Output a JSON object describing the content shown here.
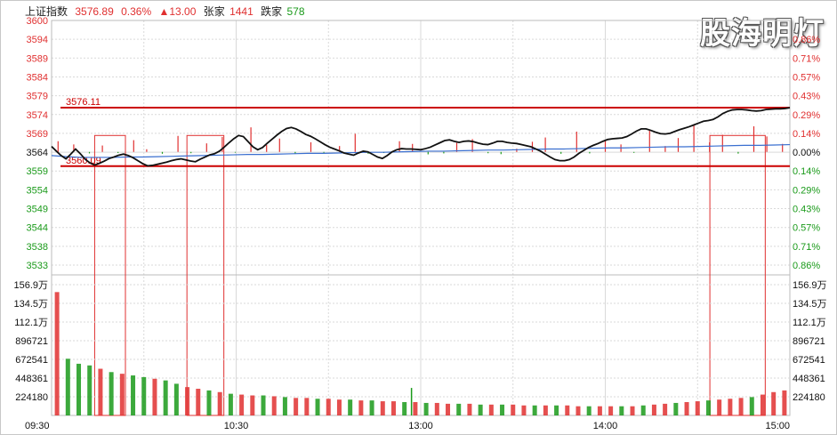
{
  "header": {
    "index_name": "上证指数",
    "price": "3576.89",
    "change_pct": "0.36%",
    "change_pts": "▲13.00",
    "up_label": "张家",
    "up_count": "1441",
    "down_label": "跌家",
    "down_count": "578"
  },
  "watermark": "股海明灯",
  "colors": {
    "up": "#e03030",
    "down": "#1a9a1a",
    "index_line": "#111111",
    "avg_line": "#3a6fd0",
    "grid": "#d9d9d9",
    "ref": "#cc0000"
  },
  "chart_data": [
    {
      "type": "line",
      "y_ticks_left": [
        "3600",
        "3594",
        "3589",
        "3584",
        "3579",
        "3574",
        "3569",
        "3564",
        "3559",
        "3554",
        "3549",
        "3544",
        "3538",
        "3533"
      ],
      "y_ticks_right": [
        "0.86%",
        "0.71%",
        "0.57%",
        "0.43%",
        "0.29%",
        "0.14%",
        "0.00%",
        "0.14%",
        "0.29%",
        "0.43%",
        "0.57%",
        "0.71%",
        "0.86%"
      ],
      "ylim": [
        3533,
        3600
      ],
      "prev_close": 3564,
      "x_ticks": [
        "09:30",
        "10:30",
        "13:00",
        "14:00",
        "15:00"
      ],
      "annotations": [
        {
          "text": "3576.11",
          "value": 3576.11
        },
        {
          "text": "3560.09",
          "value": 3560.09
        }
      ],
      "series": [],
      "price": [
        3565.5,
        3564.2,
        3563.0,
        3562.1,
        3563.4,
        3564.8,
        3563.5,
        3562.0,
        3561.0,
        3560.4,
        3560.9,
        3561.5,
        3562.2,
        3562.6,
        3563.1,
        3563.4,
        3563.0,
        3562.4,
        3561.6,
        3560.8,
        3560.2,
        3560.3,
        3560.6,
        3560.9,
        3561.2,
        3561.6,
        3561.9,
        3562.1,
        3561.8,
        3561.5,
        3561.3,
        3562.0,
        3562.6,
        3563.2,
        3563.5,
        3564.2,
        3565.3,
        3566.5,
        3567.6,
        3568.5,
        3568.2,
        3566.8,
        3565.4,
        3564.6,
        3565.2,
        3566.4,
        3567.5,
        3568.6,
        3569.6,
        3570.4,
        3570.7,
        3570.3,
        3569.6,
        3568.8,
        3568.3,
        3567.6,
        3566.8,
        3566.0,
        3565.3,
        3564.8,
        3564.3,
        3563.7,
        3563.4,
        3563.1,
        3563.7,
        3564.2,
        3564.0,
        3563.3,
        3562.6,
        3562.2,
        3563.0,
        3564.0,
        3564.6,
        3564.9,
        3564.8,
        3564.8,
        3564.7,
        3564.6,
        3564.9,
        3565.3,
        3565.9,
        3566.5,
        3567.1,
        3567.3,
        3566.9,
        3566.6,
        3566.9,
        3567.0,
        3566.8,
        3566.4,
        3566.1,
        3566.0,
        3566.4,
        3566.9,
        3566.9,
        3566.6,
        3566.4,
        3566.3,
        3566.0,
        3565.7,
        3565.4,
        3564.8,
        3564.2,
        3563.4,
        3562.6,
        3561.9,
        3561.6,
        3561.6,
        3561.9,
        3562.6,
        3563.6,
        3564.4,
        3565.2,
        3565.8,
        3566.3,
        3566.9,
        3567.4,
        3567.6,
        3567.7,
        3567.8,
        3568.2,
        3568.9,
        3569.7,
        3570.3,
        3570.3,
        3569.9,
        3569.4,
        3569.0,
        3568.9,
        3569.1,
        3569.6,
        3570.1,
        3570.5,
        3570.9,
        3571.4,
        3571.9,
        3572.4,
        3572.6,
        3572.9,
        3573.6,
        3574.5,
        3575.1,
        3575.5,
        3575.6,
        3575.6,
        3575.5,
        3575.3,
        3575.2,
        3575.3,
        3575.6,
        3575.7,
        3575.8,
        3575.8,
        3575.9,
        3576.1
      ],
      "avg": [
        3563.0,
        3562.7,
        3562.5,
        3562.5,
        3562.5,
        3562.6,
        3562.6,
        3562.7,
        3562.8,
        3562.9,
        3563.0,
        3563.1,
        3563.2,
        3563.3,
        3563.3,
        3563.4,
        3563.5,
        3563.6,
        3563.6,
        3563.7,
        3563.8,
        3563.9,
        3563.9,
        3564.0,
        3564.1,
        3564.2,
        3564.2,
        3564.3,
        3564.4,
        3564.5,
        3564.5,
        3564.6,
        3564.7,
        3564.8,
        3564.8,
        3564.9,
        3565.0,
        3565.1,
        3565.1,
        3565.2,
        3565.3,
        3565.4,
        3565.4,
        3565.5,
        3565.6,
        3565.7,
        3565.8,
        3565.8,
        3565.9,
        3566.0
      ],
      "bars_top": [
        {
          "v": 2.0,
          "c": "up"
        },
        {
          "v": 1.4,
          "c": "up"
        },
        {
          "v": 0.8,
          "c": "down"
        },
        {
          "v": 1.2,
          "c": "up"
        },
        {
          "v": 0.6,
          "c": "down"
        },
        {
          "v": 2.2,
          "c": "up"
        },
        {
          "v": 0.5,
          "c": "up"
        },
        {
          "v": 1.0,
          "c": "down"
        },
        {
          "v": 3.0,
          "c": "up"
        },
        {
          "v": 0.7,
          "c": "down"
        },
        {
          "v": 1.6,
          "c": "up"
        },
        {
          "v": 2.8,
          "c": "up"
        },
        {
          "v": 0.4,
          "c": "down"
        },
        {
          "v": 4.6,
          "c": "up"
        },
        {
          "v": 1.3,
          "c": "up"
        },
        {
          "v": 2.5,
          "c": "up"
        },
        {
          "v": 0.9,
          "c": "down"
        },
        {
          "v": 1.8,
          "c": "up"
        },
        {
          "v": 0.5,
          "c": "down"
        },
        {
          "v": 1.1,
          "c": "up"
        },
        {
          "v": 3.4,
          "c": "up"
        },
        {
          "v": 1.0,
          "c": "down"
        },
        {
          "v": 0.6,
          "c": "down"
        },
        {
          "v": 2.0,
          "c": "up"
        },
        {
          "v": 1.5,
          "c": "up"
        },
        {
          "v": 1.3,
          "c": "down"
        },
        {
          "v": 0.8,
          "c": "down"
        },
        {
          "v": 1.7,
          "c": "up"
        },
        {
          "v": 2.4,
          "c": "up"
        },
        {
          "v": 0.7,
          "c": "down"
        },
        {
          "v": 1.2,
          "c": "down"
        },
        {
          "v": 0.6,
          "c": "up"
        },
        {
          "v": 1.9,
          "c": "up"
        },
        {
          "v": 2.7,
          "c": "up"
        },
        {
          "v": 1.0,
          "c": "down"
        },
        {
          "v": 3.8,
          "c": "up"
        },
        {
          "v": 0.8,
          "c": "down"
        },
        {
          "v": 2.2,
          "c": "up"
        },
        {
          "v": 1.4,
          "c": "up"
        },
        {
          "v": 0.5,
          "c": "down"
        },
        {
          "v": 4.2,
          "c": "up"
        },
        {
          "v": 1.1,
          "c": "up"
        },
        {
          "v": 2.6,
          "c": "up"
        },
        {
          "v": 5.0,
          "c": "up"
        },
        {
          "v": 1.8,
          "c": "up"
        },
        {
          "v": 3.2,
          "c": "up"
        },
        {
          "v": 0.9,
          "c": "down"
        },
        {
          "v": 4.8,
          "c": "up"
        },
        {
          "v": 2.9,
          "c": "up"
        },
        {
          "v": 1.5,
          "c": "up"
        }
      ],
      "boxes": [
        {
          "from": "09:44",
          "to": "09:54"
        },
        {
          "from": "10:14",
          "to": "10:26"
        },
        {
          "from": "14:34",
          "to": "14:52"
        }
      ]
    },
    {
      "type": "bar",
      "y_ticks_left": [
        "156.9万",
        "134.5万",
        "112.1万",
        "896721",
        "672541",
        "448361",
        "224180"
      ],
      "y_ticks_right": [
        "156.9万",
        "134.5万",
        "112.1万",
        "896721",
        "672541",
        "448361",
        "224180"
      ],
      "unit_max": 1569000,
      "volume": [
        1480000,
        680000,
        620000,
        600000,
        560000,
        520000,
        500000,
        480000,
        460000,
        440000,
        420000,
        380000,
        340000,
        320000,
        300000,
        280000,
        260000,
        250000,
        240000,
        240000,
        230000,
        220000,
        210000,
        210000,
        200000,
        200000,
        190000,
        190000,
        180000,
        180000,
        170000,
        170000,
        160000,
        160000,
        150000,
        150000,
        140000,
        140000,
        140000,
        130000,
        130000,
        130000,
        130000,
        120000,
        120000,
        120000,
        120000,
        120000,
        110000,
        110000,
        110000,
        110000,
        110000,
        110000,
        120000,
        130000,
        140000,
        150000,
        160000,
        170000,
        180000,
        190000,
        200000,
        210000,
        220000,
        250000,
        280000,
        300000
      ],
      "volume_up": [
        true,
        false,
        false,
        false,
        true,
        false,
        true,
        false,
        false,
        true,
        false,
        false,
        true,
        true,
        false,
        true,
        false,
        true,
        true,
        false,
        true,
        false,
        true,
        true,
        false,
        true,
        true,
        false,
        true,
        false,
        true,
        true,
        false,
        true,
        false,
        true,
        true,
        false,
        true,
        false,
        true,
        false,
        true,
        true,
        false,
        true,
        false,
        true,
        true,
        false,
        true,
        true,
        false,
        true,
        false,
        true,
        true,
        false,
        true,
        true,
        false,
        true,
        true,
        true,
        false,
        true,
        true,
        true
      ],
      "spike_at": "12:57",
      "spike_value": 330000
    }
  ]
}
